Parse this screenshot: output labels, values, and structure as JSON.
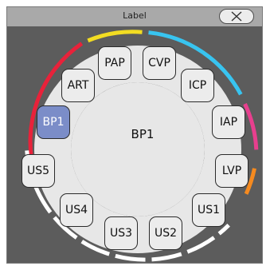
{
  "window": {
    "title": "Label",
    "close_icon": "close-icon"
  },
  "selected_label": "BP1",
  "chips": [
    {
      "label": "PAP"
    },
    {
      "label": "CVP"
    },
    {
      "label": "ICP"
    },
    {
      "label": "IAP"
    },
    {
      "label": "LVP"
    },
    {
      "label": "US1"
    },
    {
      "label": "US2"
    },
    {
      "label": "US3"
    },
    {
      "label": "US4"
    },
    {
      "label": "US5"
    },
    {
      "label": "BP1"
    },
    {
      "label": "ART"
    }
  ],
  "colors": {
    "window_bg": "#5c5c5c",
    "ring": "#e7e7e7",
    "chip_bg": "#ececec",
    "chip_selected": "#7b8dc8",
    "arc_red": "#e8223a",
    "arc_yellow": "#f2dc22",
    "arc_cyan": "#38c4f0",
    "arc_magenta": "#e83f8e",
    "arc_orange": "#f58a1f",
    "arc_white": "#ffffff"
  }
}
